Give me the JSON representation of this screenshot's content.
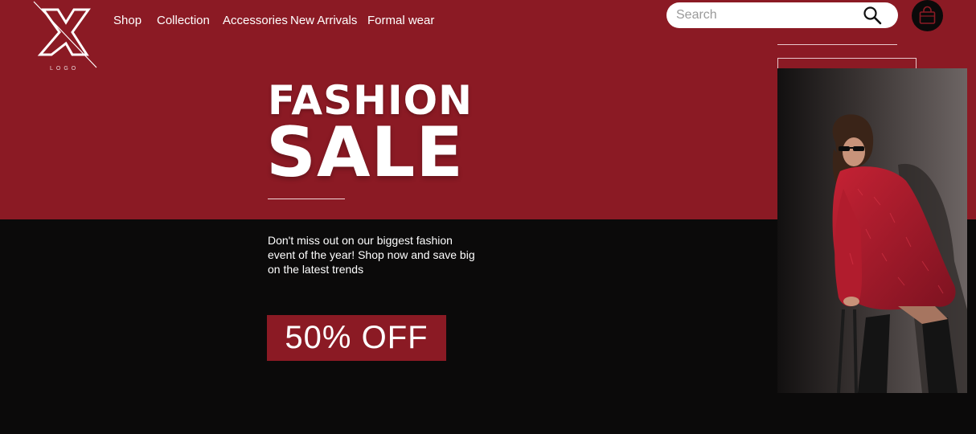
{
  "brand": {
    "logo_caption": "LOGO"
  },
  "nav": {
    "items": [
      {
        "label": "Shop"
      },
      {
        "label": "Collection"
      },
      {
        "label": "Accessories"
      },
      {
        "label": "New Arrivals"
      },
      {
        "label": "Formal wear"
      }
    ]
  },
  "search": {
    "placeholder": "Search",
    "value": "",
    "icon": "search-icon"
  },
  "cart": {
    "icon": "shopping-bag-icon"
  },
  "hero": {
    "title_line1": "FASHION",
    "title_line2": "SALE",
    "description": "Don't miss out on our biggest fashion event of the year! Shop now and save big on the latest trends",
    "cta_label": "50% OFF"
  },
  "colors": {
    "brand_red": "#8b1a24",
    "dark": "#0b0a0a",
    "white": "#ffffff"
  }
}
